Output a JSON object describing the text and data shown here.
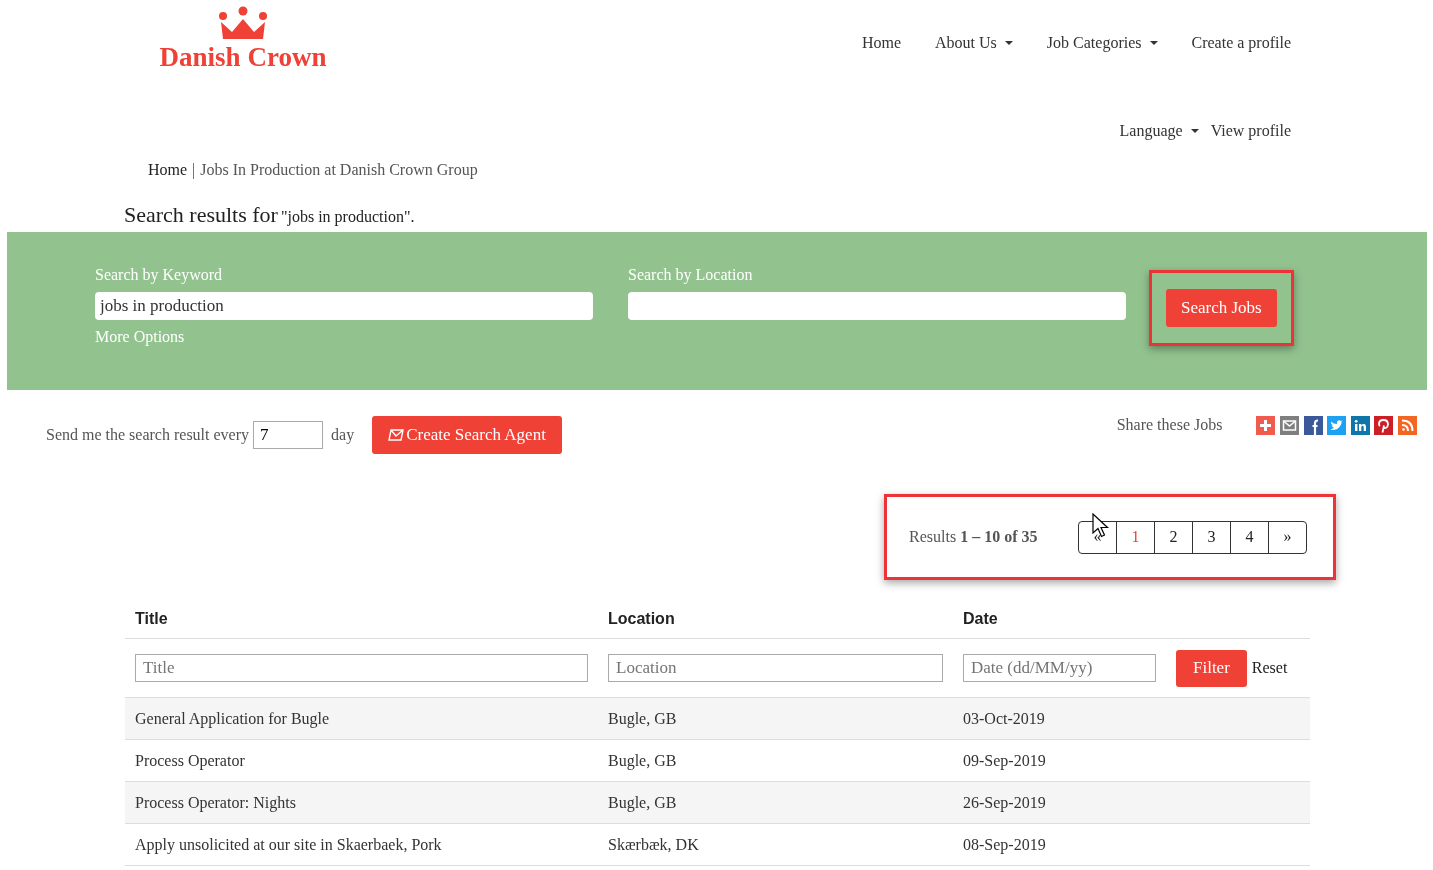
{
  "logo": {
    "text": "Danish Crown"
  },
  "nav": [
    {
      "label": "Home",
      "dropdown": false
    },
    {
      "label": "About Us",
      "dropdown": true
    },
    {
      "label": "Job Categories",
      "dropdown": true
    },
    {
      "label": "Create a profile",
      "dropdown": false
    }
  ],
  "nav_secondary": [
    {
      "label": "Language",
      "dropdown": true
    },
    {
      "label": "View profile",
      "dropdown": false
    }
  ],
  "breadcrumb": {
    "home": "Home",
    "separator": "|",
    "current": "Jobs In Production at Danish Crown Group"
  },
  "results_heading": {
    "label": "Search results for",
    "query": "\"jobs in production\"."
  },
  "search": {
    "keyword_label": "Search by Keyword",
    "keyword_value": "jobs in production",
    "location_label": "Search by Location",
    "more_options": "More Options",
    "button": "Search Jobs",
    "button_highlighted": true
  },
  "agent": {
    "label": "Send me the search result every",
    "value": "7",
    "unit": "day",
    "button": "Create Search Agent"
  },
  "share": {
    "label": "Share these Jobs",
    "icons": [
      {
        "kind": "plus"
      },
      {
        "kind": "mail"
      },
      {
        "kind": "facebook"
      },
      {
        "kind": "twitter"
      },
      {
        "kind": "linkedin"
      },
      {
        "kind": "pinterest"
      },
      {
        "kind": "rss"
      }
    ]
  },
  "pagination": {
    "summary": "Results **1 – 10 of 35**",
    "highlighted": true,
    "pages": [
      {
        "label": "«",
        "selected": false
      },
      {
        "label": "1",
        "selected": true
      },
      {
        "label": "2",
        "selected": false
      },
      {
        "label": "3",
        "selected": false
      },
      {
        "label": "4",
        "selected": false
      },
      {
        "label": "»",
        "selected": false
      }
    ]
  },
  "table": {
    "columns": [
      "Title",
      "Location",
      "Date"
    ],
    "filter_placeholders": [
      "Title",
      "Location",
      "Date (dd/MM/yy)"
    ],
    "filter_button": "Filter",
    "reset": "Reset",
    "rows": [
      [
        "General Application for Bugle",
        "Bugle, GB",
        "03-Oct-2019"
      ],
      [
        "Process Operator",
        "Bugle, GB",
        "09-Sep-2019"
      ],
      [
        "Process Operator: Nights",
        "Bugle, GB",
        "26-Sep-2019"
      ],
      [
        "Apply unsolicited at our site in Skaerbaek, Pork",
        "Skærbæk, DK",
        "08-Sep-2019"
      ]
    ]
  }
}
